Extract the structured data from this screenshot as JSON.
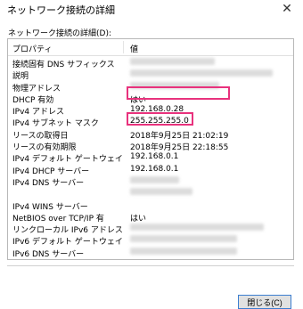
{
  "window": {
    "title": "ネットワーク接続の詳細",
    "close_glyph": "✕"
  },
  "details": {
    "label": "ネットワーク接続の詳細(D):",
    "columns": {
      "property": "プロパティ",
      "value": "値"
    },
    "rows": [
      {
        "property": "接続固有 DNS サフィックス",
        "value": ""
      },
      {
        "property": "説明",
        "value": ""
      },
      {
        "property": "物理アドレス",
        "value": ""
      },
      {
        "property": "DHCP 有効",
        "value": "はい"
      },
      {
        "property": "IPv4 アドレス",
        "value": "192.168.0.28"
      },
      {
        "property": "IPv4 サブネット マスク",
        "value": "255.255.255.0"
      },
      {
        "property": "リースの取得日",
        "value": "2018年9月25日 21:02:19"
      },
      {
        "property": "リースの有効期限",
        "value": "2018年9月25日 22:18:55"
      },
      {
        "property": "IPv4 デフォルト ゲートウェイ",
        "value": "192.168.0.1"
      },
      {
        "property": "IPv4 DHCP サーバー",
        "value": "192.168.0.1"
      },
      {
        "property": "IPv4 DNS サーバー",
        "value": ""
      },
      {
        "property": "",
        "value": ""
      },
      {
        "property": "IPv4 WINS サーバー",
        "value": ""
      },
      {
        "property": "NetBIOS over TCP/IP 有",
        "value": "はい"
      },
      {
        "property": "リンクローカル IPv6 アドレス",
        "value": ""
      },
      {
        "property": "IPv6 デフォルト ゲートウェイ",
        "value": ""
      },
      {
        "property": "IPv6 DNS サーバー",
        "value": ""
      }
    ]
  },
  "highlight_color": "#e8327d",
  "buttons": {
    "close_label": "閉じる(C)"
  }
}
